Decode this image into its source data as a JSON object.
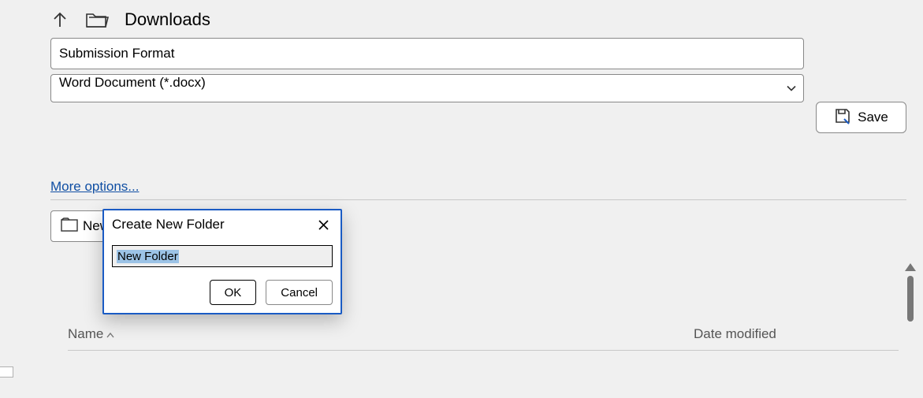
{
  "path": {
    "location": "Downloads"
  },
  "filename": {
    "value": "Submission Format"
  },
  "filetype": {
    "selected": "Word Document (*.docx)"
  },
  "buttons": {
    "save": "Save",
    "new_folder": "New Folder"
  },
  "links": {
    "more_options": "More options..."
  },
  "table": {
    "columns": {
      "name": "Name",
      "date": "Date modified"
    }
  },
  "dialog": {
    "title": "Create New Folder",
    "input_value": "New Folder",
    "ok": "OK",
    "cancel": "Cancel"
  }
}
